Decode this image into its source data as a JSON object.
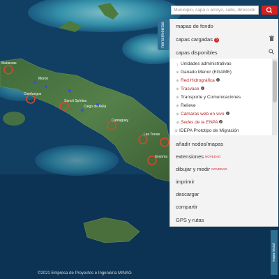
{
  "search": {
    "placeholder": "Municipio, capa o arroyo, calle, dirección"
  },
  "side_tab": {
    "label": "herramientas"
  },
  "right_tab": {
    "label": "mapa inicial"
  },
  "panel": {
    "sections_top": [
      {
        "label": "mapas de fondo"
      },
      {
        "label": "capas cargadas",
        "badge": "5",
        "icon": "trash-icon"
      },
      {
        "label": "capas disponibles",
        "icon": "search-icon"
      }
    ],
    "layers": [
      {
        "label": "Unidades administrativas",
        "red": false,
        "info": false
      },
      {
        "label": "Ganado Menor (EGAME)",
        "red": false,
        "info": false
      },
      {
        "label": "Red Hidrográfica",
        "red": true,
        "info": true
      },
      {
        "label": "Trasvase",
        "red": true,
        "info": true
      },
      {
        "label": "Transporte y Comunicaciones",
        "red": false,
        "info": false
      },
      {
        "label": "Relieve",
        "red": false,
        "info": false
      },
      {
        "label": "Cámaras web en vivo",
        "red": true,
        "info": true
      },
      {
        "label": "Sedes de la ENPA",
        "red": true,
        "info": true
      },
      {
        "label": "IDEPA Prototipo de Migración",
        "red": false,
        "info": false
      }
    ],
    "sections_bottom": [
      {
        "label": "añadir nodos/mapas",
        "novedad": ""
      },
      {
        "label": "extensiones",
        "novedad": "NOVEDAD"
      },
      {
        "label": "dibujar y medir",
        "novedad": "NOVEDAD"
      },
      {
        "label": "imprimir",
        "novedad": ""
      },
      {
        "label": "descargar",
        "novedad": ""
      },
      {
        "label": "compartir",
        "novedad": ""
      },
      {
        "label": "GPS y rutas",
        "novedad": ""
      }
    ]
  },
  "map": {
    "labels": [
      "Matanzas",
      "Cienfuegos",
      "Sancti Spíritus",
      "Camagüey",
      "Las Tunas",
      "Granma",
      "Moron",
      "Ciego de Ávila"
    ]
  },
  "attribution": "©2021 Empresa de Proyectos e Ingeniería MINAG"
}
